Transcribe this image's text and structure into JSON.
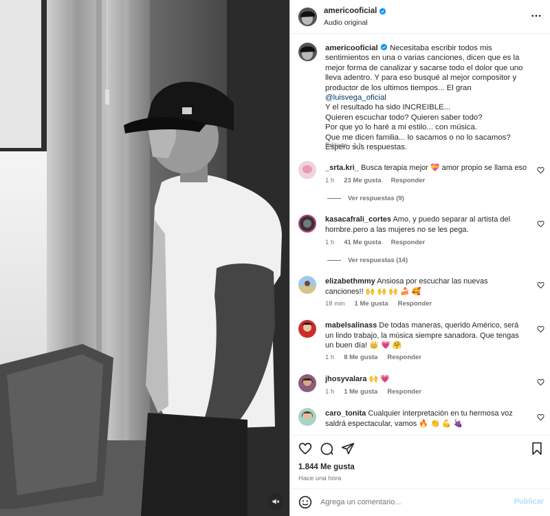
{
  "header": {
    "username": "americooficial",
    "subtitle": "Audio original"
  },
  "caption": {
    "username": "americooficial",
    "text_part1": " Necesitaba escribir todos mis sentimientos en una o varias canciones, dicen que es la mejor forma de canalizar y sacarse todo el dolor que uno lleva adentro. Y para eso busqué al mejor compositor y productor de los ultimos tiempos... El gran",
    "mention": "@luisvega_oficial",
    "line2": "Y el resultado ha sido INCREIBLE...",
    "line3": "Quieren escuchar todo? Quieren saber todo?",
    "line4": "Por que yo lo haré a mi estilo... con música.",
    "line5": "Que me dicen familia... lo sacamos o no lo sacamos?",
    "line6": "Espero sus respuestas.",
    "edited": "Editado · 1 h"
  },
  "comments": [
    {
      "username": "_srta.kri_",
      "text": " Busca terapia mejor 💝 amor propio se llama eso",
      "time": "1 h",
      "likes": "23 Me gusta",
      "reply": "Responder",
      "view_replies": "Ver respuestas (9)"
    },
    {
      "username": "kasacafrali_cortes",
      "text": " Amo, y puedo separar al artista del hombre.pero a las mujeres no se les pega.",
      "time": "1 h",
      "likes": "41 Me gusta",
      "reply": "Responder",
      "view_replies": "Ver respuestas (14)"
    },
    {
      "username": "elizabethmmy",
      "text": " Ansiosa por escuchar las nuevas canciones!! 🙌 🙌 🙌 🍰 🥰",
      "time": "18 min",
      "likes": "1 Me gusta",
      "reply": "Responder"
    },
    {
      "username": "mabelsalinass",
      "text": " De todas maneras, querido Américo, será un lindo trabajo, la música siempre sanadora. Que tengas un buen día! 👑 💗 🤗",
      "time": "1 h",
      "likes": "8 Me gusta",
      "reply": "Responder"
    },
    {
      "username": "jhosyvalara",
      "text": " 🙌 💗",
      "time": "1 h",
      "likes": "1 Me gusta",
      "reply": "Responder"
    },
    {
      "username": "caro_tonita",
      "text": " Cualquier interpretación en tu hermosa voz saldrá espectacular, vamos 🔥 👏 💪 🍇"
    }
  ],
  "footer": {
    "likes": "1.844 Me gusta",
    "time_ago": "Hace una hora",
    "comment_placeholder": "Agrega un comentario...",
    "post_label": "Publicar"
  },
  "colors": {
    "link": "#00376b",
    "muted": "#737373",
    "verified": "#0095f6",
    "post_disabled": "#b2dffc"
  },
  "icons": [
    "verified-badge-icon",
    "more-options-icon",
    "heart-icon",
    "comment-icon",
    "share-icon",
    "bookmark-icon",
    "emoji-icon",
    "mute-icon"
  ]
}
